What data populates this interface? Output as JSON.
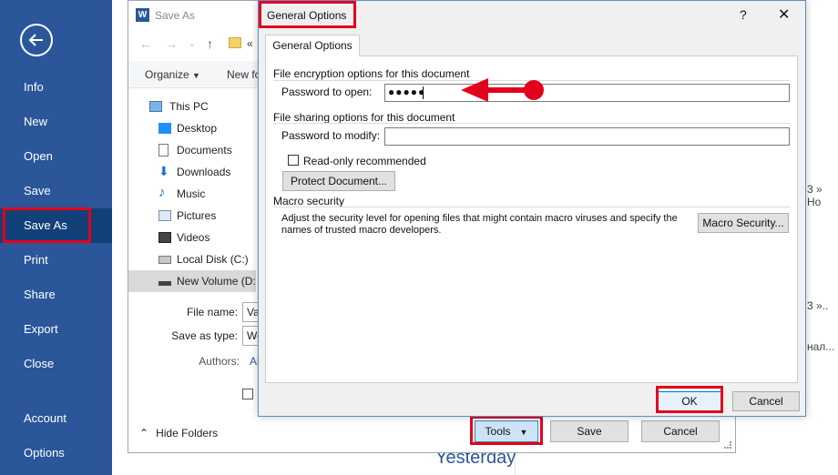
{
  "backstage": {
    "items": [
      {
        "label": "Info"
      },
      {
        "label": "New"
      },
      {
        "label": "Open"
      },
      {
        "label": "Save"
      },
      {
        "label": "Save As"
      },
      {
        "label": "Print"
      },
      {
        "label": "Share"
      },
      {
        "label": "Export"
      },
      {
        "label": "Close"
      },
      {
        "label": "Account"
      },
      {
        "label": "Options"
      }
    ],
    "selected": "Save As",
    "bg_color": "#2b579a"
  },
  "backdrop": {
    "fragments": [
      "3 » Ho",
      "3 »..",
      "нал..."
    ],
    "yesterday_label": "Yesterday"
  },
  "save_as": {
    "title": "Save As",
    "path_crumb": "«",
    "toolbar": {
      "organize": "Organize",
      "new_folder": "New fo"
    },
    "tree": [
      {
        "label": "This PC",
        "icon": "pc-icon"
      },
      {
        "label": "Desktop",
        "icon": "desktop-icon"
      },
      {
        "label": "Documents",
        "icon": "documents-icon"
      },
      {
        "label": "Downloads",
        "icon": "download-icon"
      },
      {
        "label": "Music",
        "icon": "music-icon"
      },
      {
        "label": "Pictures",
        "icon": "pictures-icon"
      },
      {
        "label": "Videos",
        "icon": "videos-icon"
      },
      {
        "label": "Local Disk (C:)",
        "icon": "drive-icon"
      },
      {
        "label": "New Volume (D:",
        "icon": "drive-icon"
      }
    ],
    "file_name_label": "File name:",
    "file_name_value": "Va",
    "save_type_label": "Save as type:",
    "save_type_value": "Wo",
    "authors_label": "Authors:",
    "authors_value": "Al",
    "hide_folders_label": "Hide Folders",
    "buttons": {
      "tools": "Tools",
      "save": "Save",
      "cancel": "Cancel"
    }
  },
  "general_options": {
    "title": "General Options",
    "tab": "General Options",
    "encryption_group": "File encryption options for this document",
    "password_open_label": "Password to open:",
    "password_open_value": "●●●●●",
    "sharing_group": "File sharing options for this document",
    "password_modify_label": "Password to modify:",
    "password_modify_value": "",
    "readonly_label": "Read-only recommended",
    "protect_button": "Protect Document...",
    "macro_group": "Macro security",
    "macro_text": "Adjust the security level for opening files that might contain macro viruses and specify the names of trusted macro developers.",
    "macro_button": "Macro Security...",
    "ok_button": "OK",
    "cancel_button": "Cancel",
    "help_glyph": "?",
    "close_glyph": "✕"
  },
  "annotation_color": "#e3001b"
}
